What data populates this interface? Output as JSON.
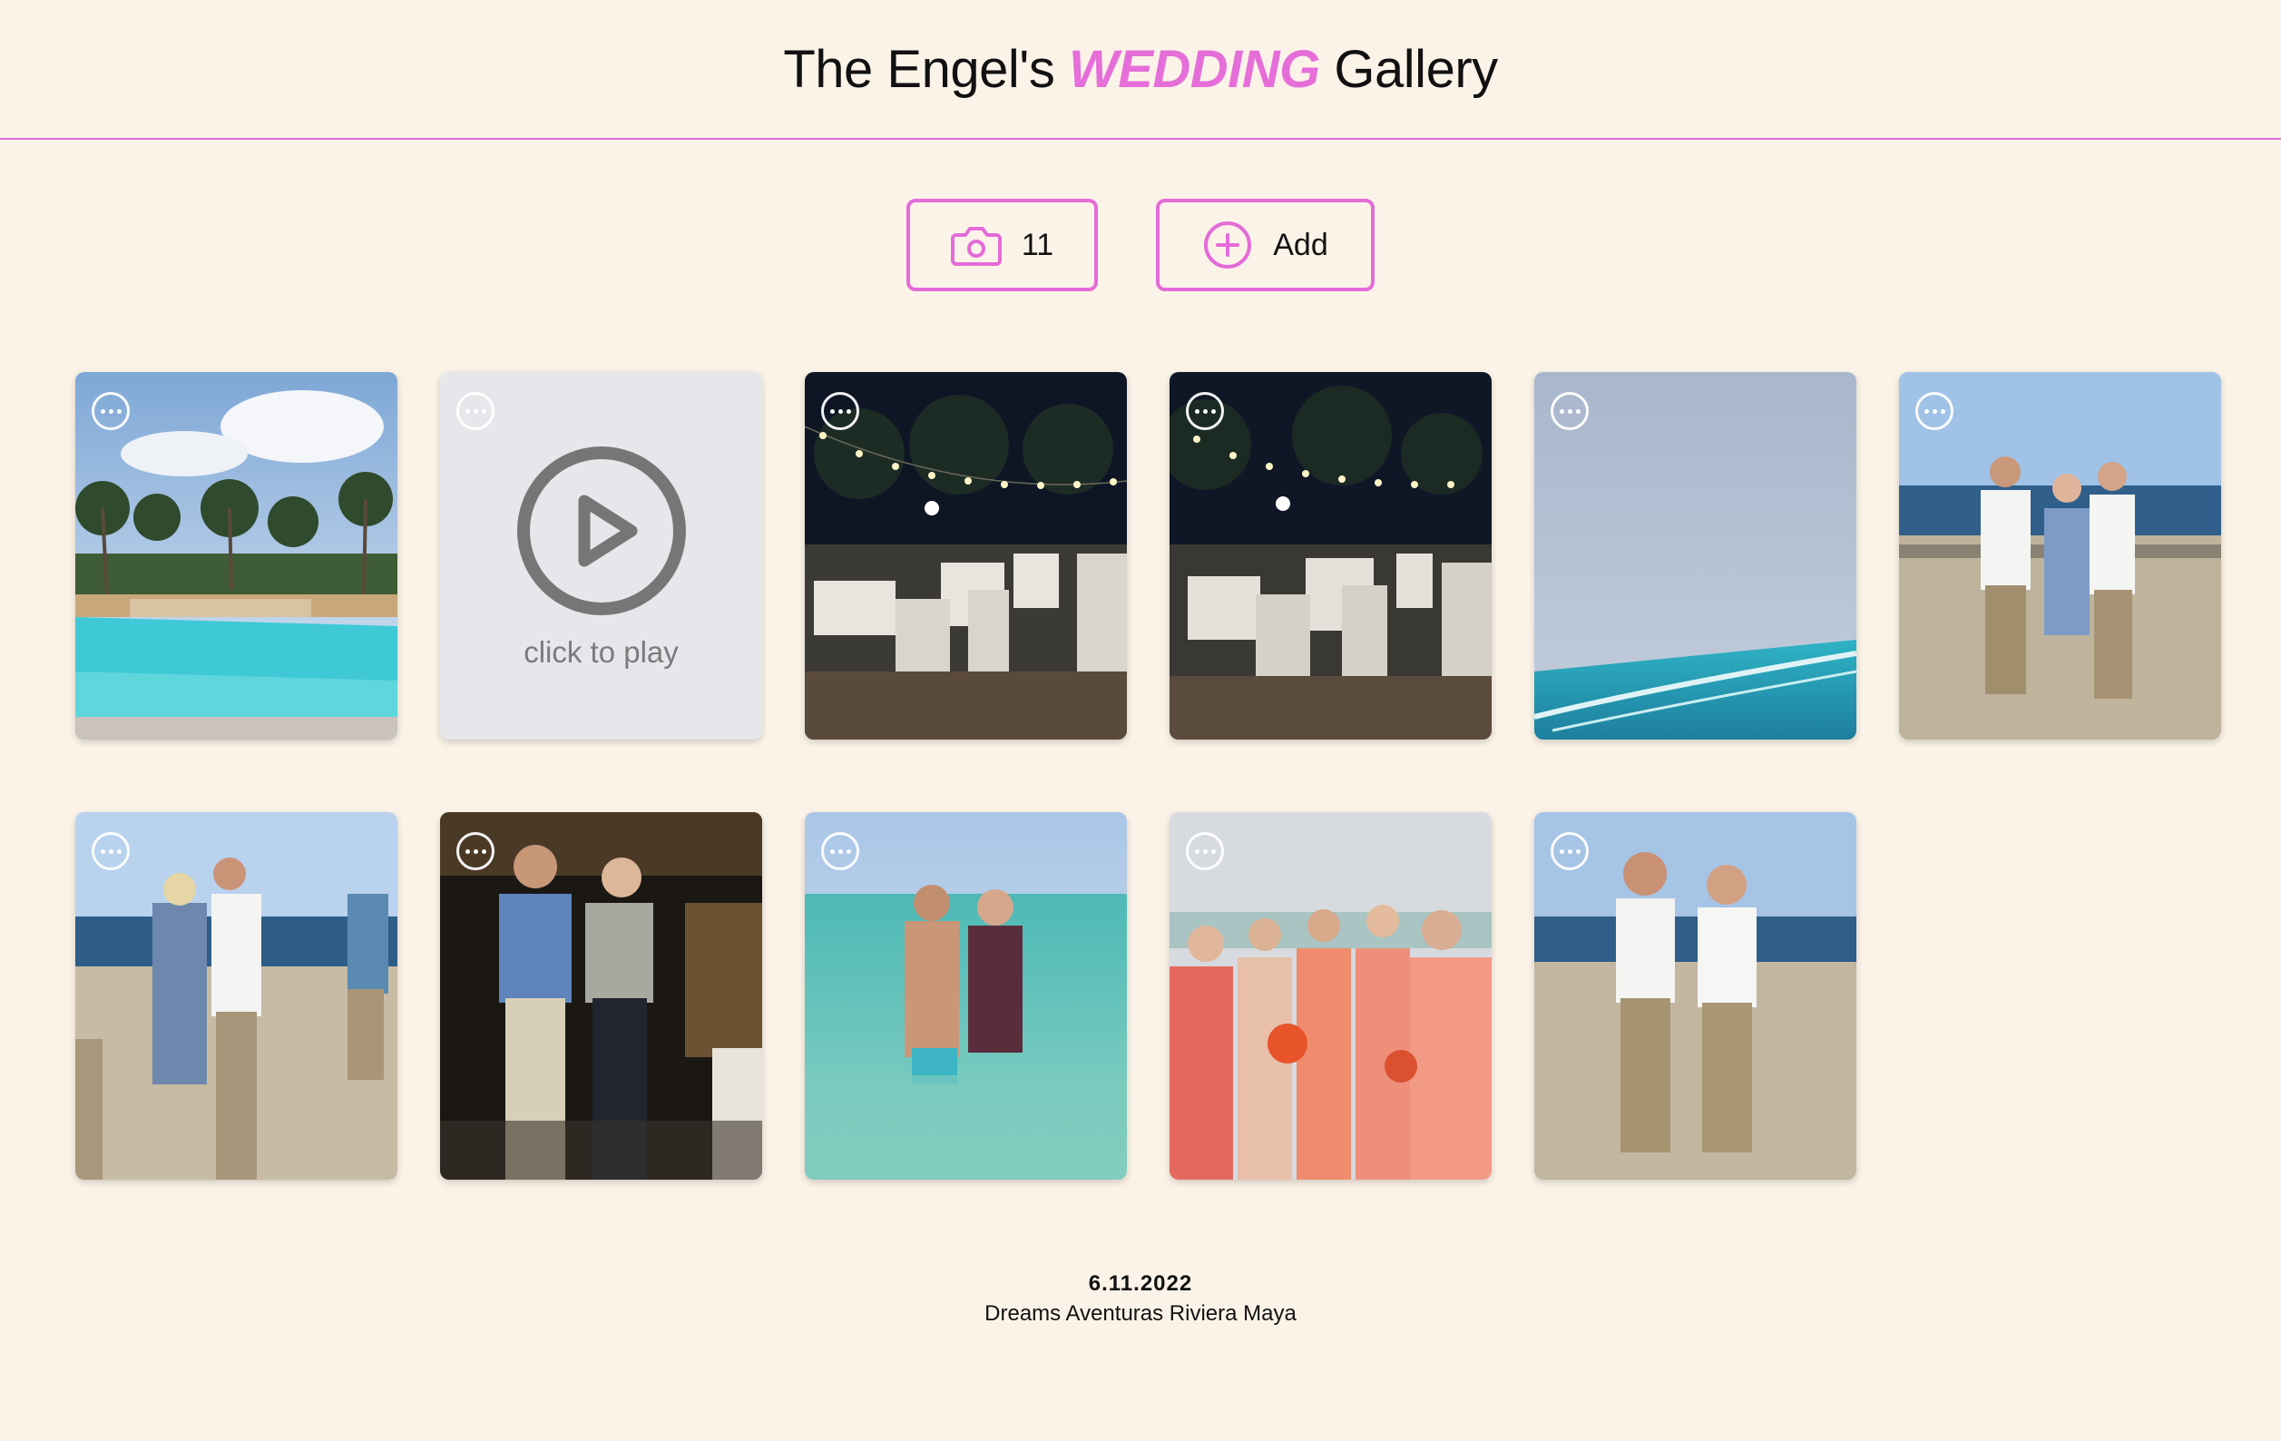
{
  "header": {
    "title_prefix": "The Engel's",
    "title_accent": "WEDDING",
    "title_suffix": "Gallery",
    "accent_color": "#e56ed9"
  },
  "toolbar": {
    "count_icon": "camera-icon",
    "count": "11",
    "add_icon": "plus-circle-icon",
    "add_label": "Add"
  },
  "gallery": {
    "items": [
      {
        "type": "photo",
        "subject": "resort pool with palm trees"
      },
      {
        "type": "video",
        "play_label": "click to play"
      },
      {
        "type": "photo",
        "subject": "night dinner under string lights"
      },
      {
        "type": "photo",
        "subject": "night dinner under string lights"
      },
      {
        "type": "photo",
        "subject": "ocean and sky"
      },
      {
        "type": "photo",
        "subject": "three people on beach"
      },
      {
        "type": "photo",
        "subject": "couple hugging on beach"
      },
      {
        "type": "photo",
        "subject": "two people at night"
      },
      {
        "type": "photo",
        "subject": "couple in the sea"
      },
      {
        "type": "photo",
        "subject": "bridesmaids toasting"
      },
      {
        "type": "photo",
        "subject": "two men on beach"
      }
    ]
  },
  "footer": {
    "date": "6.11.2022",
    "location": "Dreams Aventuras Riviera Maya"
  }
}
